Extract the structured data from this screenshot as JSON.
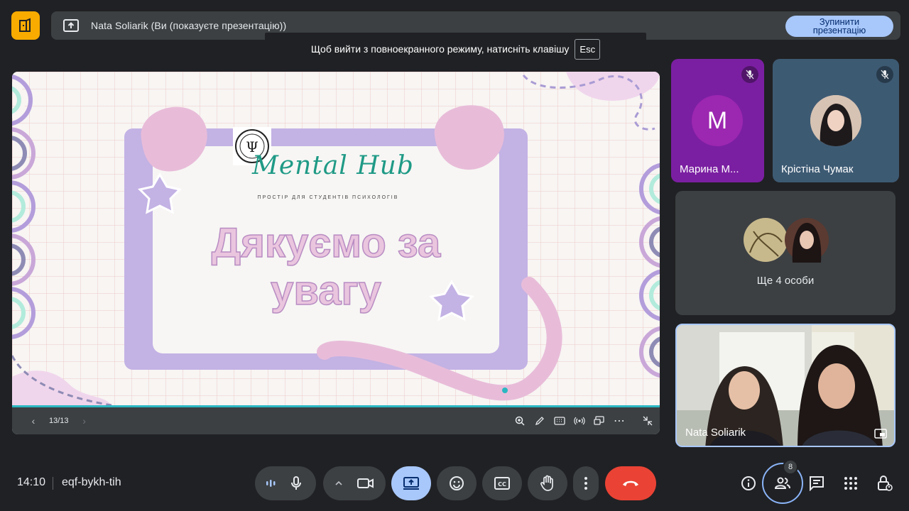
{
  "presenter_bar": {
    "title": "Nata Soliarik (Ви (показуєте презентацію))",
    "stop_button": "Зупинити презентацію"
  },
  "fullscreen_toast": {
    "text": "Щоб вийти з повноекранного режиму, натисніть клавішу",
    "key": "Esc"
  },
  "slide": {
    "brand": "Mental Hub",
    "tagline": "ПРОСТІР ДЛЯ СТУДЕНТІВ ПСИХОЛОГІВ",
    "headline": "Дякуємо за увагу",
    "page": "13/13"
  },
  "participants": {
    "tile1": {
      "name": "Марина М...",
      "initial": "M"
    },
    "tile2": {
      "name": "Крістіна Чумак"
    },
    "more": {
      "label": "Ще 4 особи"
    },
    "self": {
      "name": "Nata Soliarik"
    }
  },
  "meeting": {
    "time": "14:10",
    "code": "eqf-bykh-tih",
    "people_count": "8"
  },
  "colors": {
    "background": "#202124",
    "surface": "#3c4043",
    "accent_blue": "#a8c7fa",
    "end_call": "#ea4335",
    "logo_yellow": "#f9ab00"
  }
}
